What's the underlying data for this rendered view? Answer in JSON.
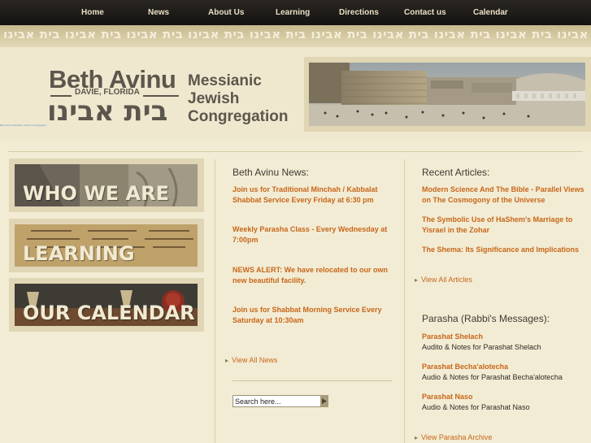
{
  "nav": {
    "items": [
      {
        "label": "Home"
      },
      {
        "label": "News"
      },
      {
        "label": "About Us"
      },
      {
        "label": "Learning"
      },
      {
        "label": "Directions"
      },
      {
        "label": "Contact us"
      },
      {
        "label": "Calendar"
      }
    ]
  },
  "band": {
    "text": "בית אבינו בית אבינו בית אבינו בית אבינו בית אבינו בית אבינו בית אבינו בית אבינו בית אבינו בית אבינו בית אבינו בית אבינו"
  },
  "header": {
    "logo_english": "Beth Avinu",
    "logo_city": "DAVIE, FLORIDA",
    "logo_hebrew": "בית אבינו",
    "tagline": [
      "Messianic",
      "Jewish",
      "Congregation"
    ],
    "tiny_link": "Beth Avinu Messianic Jewish Congregation"
  },
  "tiles": [
    {
      "label": "WHO WE ARE"
    },
    {
      "label": "LEARNING"
    },
    {
      "label": "OUR CALENDAR"
    }
  ],
  "news": {
    "heading": "Beth Avinu News:",
    "items": [
      {
        "text": "Join us for Traditional Minchah / Kabbalat Shabbat Service Every Friday at 6:30 pm"
      },
      {
        "text": "Weekly Parasha Class - Every Wednesday at 7:00pm"
      },
      {
        "text": "NEWS ALERT: We have relocated to our own new beautiful facility."
      },
      {
        "text": "Join us for Shabbat Morning Service Every Saturday at 10:30am"
      }
    ],
    "view_all": "View All News"
  },
  "search": {
    "value": "Search here..."
  },
  "articles": {
    "heading": "Recent Articles:",
    "items": [
      {
        "text": "Modern Science And The Bible - Parallel Views on The Cosmogony of the Universe"
      },
      {
        "text": "The Symbolic Use of HaShem's Marriage to Yisrael in the Zohar"
      },
      {
        "text": "The Shema: Its Significance and Implications"
      }
    ],
    "view_all": "View All Articles"
  },
  "parasha": {
    "heading": "Parasha (Rabbi's Messages):",
    "items": [
      {
        "title": "Parashat Shelach",
        "desc": "Audito & Notes for Parashat Shelach"
      },
      {
        "title": "Parashat Becha'alotecha",
        "desc": "Audio & Notes for Parashat Becha'alotecha"
      },
      {
        "title": "Parashat Naso",
        "desc": "Audio & Notes for Parashat Naso"
      }
    ],
    "view_all": "View Parasha Archive"
  },
  "colors": {
    "link": "#c8661a",
    "nav_bg": "#1c1a17",
    "page_bg": "#f2ecd4",
    "logo_text": "#5d564c"
  }
}
